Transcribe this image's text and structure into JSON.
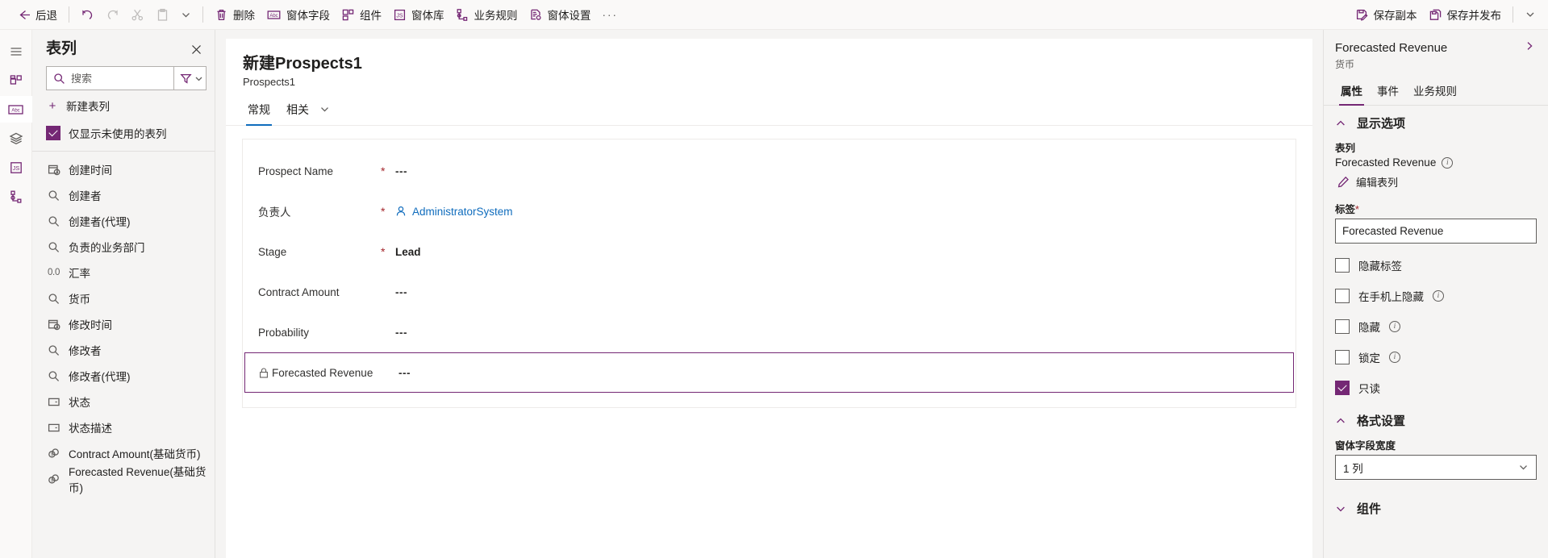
{
  "commandbar": {
    "back": "后退",
    "undo_icon": "undo-icon",
    "redo_icon": "redo-icon",
    "cut_icon": "cut-icon",
    "paste_icon": "paste-icon",
    "overflow_chevron": "chevron-down-icon",
    "delete": "删除",
    "form_fields": "窗体字段",
    "components": "组件",
    "form_libraries": "窗体库",
    "business_rules": "业务规则",
    "form_settings": "窗体设置",
    "more": "···",
    "save_copy": "保存副本",
    "save_publish": "保存并发布",
    "save_chevron": "chevron-down-icon"
  },
  "rail": {
    "items": [
      {
        "name": "menu-icon"
      },
      {
        "name": "components-icon"
      },
      {
        "name": "table-columns-icon"
      },
      {
        "name": "layers-icon"
      },
      {
        "name": "javascript-icon"
      },
      {
        "name": "business-rules-icon"
      }
    ]
  },
  "columns_pane": {
    "title": "表列",
    "close_icon": "close-icon",
    "search_placeholder": "搜索",
    "search_value": "",
    "filter_icon": "filter-icon",
    "new_column": "新建表列",
    "show_unused": "仅显示未使用的表列",
    "show_unused_checked": true,
    "items": [
      {
        "label": "创建时间",
        "icon": "datetime-icon"
      },
      {
        "label": "创建者",
        "icon": "lookup-icon"
      },
      {
        "label": "创建者(代理)",
        "icon": "lookup-icon"
      },
      {
        "label": "负责的业务部门",
        "icon": "lookup-icon"
      },
      {
        "label": "汇率",
        "icon": "decimal-icon"
      },
      {
        "label": "货币",
        "icon": "lookup-icon"
      },
      {
        "label": "修改时间",
        "icon": "datetime-icon"
      },
      {
        "label": "修改者",
        "icon": "lookup-icon"
      },
      {
        "label": "修改者(代理)",
        "icon": "lookup-icon"
      },
      {
        "label": "状态",
        "icon": "choice-icon"
      },
      {
        "label": "状态描述",
        "icon": "choice-icon"
      },
      {
        "label": "Contract Amount(基础货币)",
        "icon": "currency-icon"
      },
      {
        "label": "Forecasted Revenue(基础货币)",
        "icon": "currency-icon"
      }
    ]
  },
  "form": {
    "title": "新建Prospects1",
    "subtitle": "Prospects1",
    "tabs": [
      {
        "label": "常规",
        "selected": true
      },
      {
        "label": "相关",
        "selected": false
      }
    ],
    "tab_more_icon": "chevron-down-icon",
    "fields": [
      {
        "label": "Prospect Name",
        "required": true,
        "value": "---",
        "style": "dash",
        "locked": false,
        "selected": false
      },
      {
        "label": "负责人",
        "required": true,
        "value": "AdministratorSystem",
        "style": "link",
        "icon": "person-icon",
        "locked": false,
        "selected": false
      },
      {
        "label": "Stage",
        "required": true,
        "value": "Lead",
        "style": "bold",
        "locked": false,
        "selected": false
      },
      {
        "label": "Contract Amount",
        "required": false,
        "value": "---",
        "style": "dash",
        "locked": false,
        "selected": false
      },
      {
        "label": "Probability",
        "required": false,
        "value": "---",
        "style": "dash",
        "locked": false,
        "selected": false
      },
      {
        "label": "Forecasted Revenue",
        "required": false,
        "value": "---",
        "style": "dash",
        "locked": true,
        "selected": true
      }
    ]
  },
  "properties": {
    "title": "Forecasted Revenue",
    "subtitle": "货币",
    "expand_icon": "chevron-right-icon",
    "tabs": [
      {
        "label": "属性",
        "selected": true
      },
      {
        "label": "事件",
        "selected": false
      },
      {
        "label": "业务规则",
        "selected": false
      }
    ],
    "display_options": {
      "header": "显示选项",
      "expanded": true,
      "column_label": "表列",
      "column_value": "Forecasted Revenue",
      "edit_column": "编辑表列",
      "label_label": "标签",
      "label_required": "*",
      "label_value": "Forecasted Revenue",
      "checkboxes": [
        {
          "label": "隐藏标签",
          "checked": false,
          "info": false
        },
        {
          "label": "在手机上隐藏",
          "checked": false,
          "info": true
        },
        {
          "label": "隐藏",
          "checked": false,
          "info": true
        },
        {
          "label": "锁定",
          "checked": false,
          "info": true
        },
        {
          "label": "只读",
          "checked": true,
          "info": false
        }
      ]
    },
    "format_settings": {
      "header": "格式设置",
      "expanded": true,
      "width_label": "窗体字段宽度",
      "width_value": "1 列",
      "width_chevron": "chevron-down-icon"
    },
    "components": {
      "header": "组件",
      "expanded": false
    }
  },
  "colors": {
    "accent": "#742774",
    "tab_accent": "#0f6cbd",
    "required": "#a4262c",
    "link": "#0f6cbd",
    "panel_bg": "#f5f4f3"
  }
}
